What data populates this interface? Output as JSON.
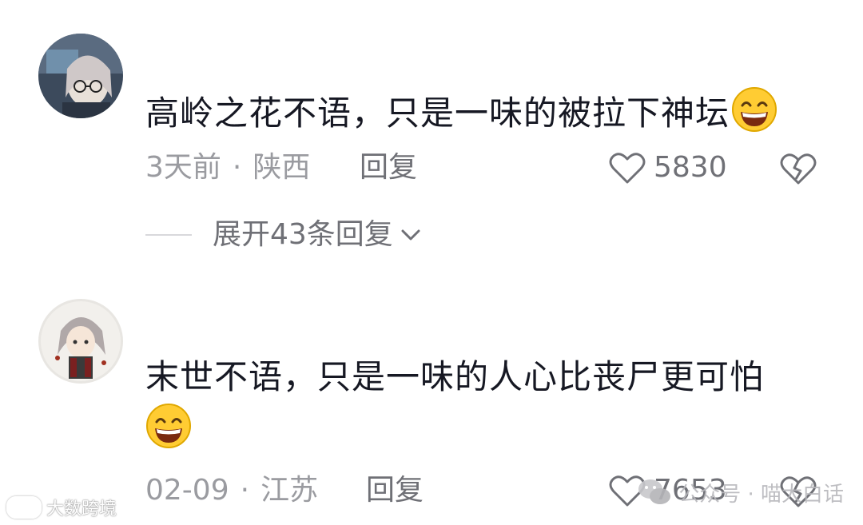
{
  "comments": [
    {
      "text": "高岭之花不语，只是一味的被拉下神坛",
      "emoji": "grinning-face",
      "time": "3天前",
      "location": "陕西",
      "reply_label": "回复",
      "likes": "5830",
      "expand_label": "展开43条回复"
    },
    {
      "text": "末世不语，只是一味的人心比丧尸更可怕",
      "emoji": "grinning-face",
      "time": "02-09",
      "location": "江苏",
      "reply_label": "回复",
      "likes": "7653"
    }
  ],
  "separator": "·",
  "watermarks": {
    "left": "大数跨境",
    "right": "公众号 · 喵大白话"
  },
  "colors": {
    "text": "#161823",
    "meta": "#9a9ba0",
    "action": "#6f7076",
    "emoji_face": "#ffcc33"
  }
}
